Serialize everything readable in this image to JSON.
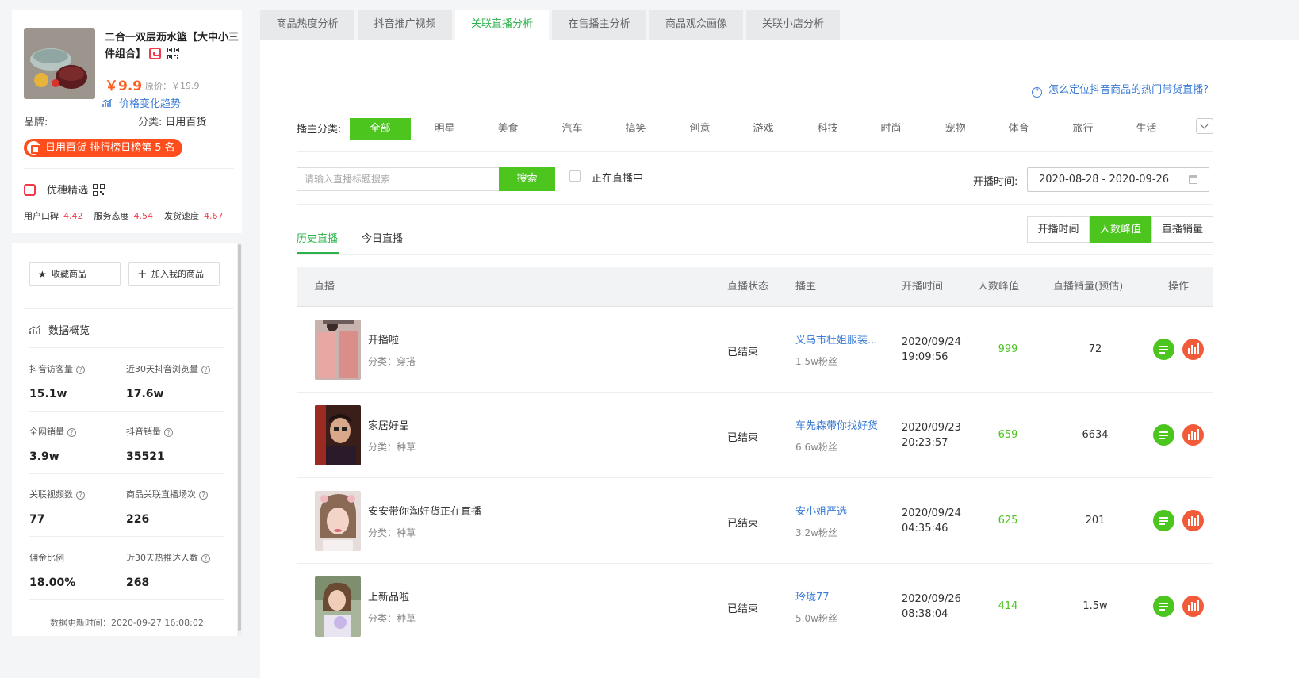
{
  "product": {
    "name": "二合一双层沥水篮【大中小三件组合】",
    "price": "￥9.9",
    "original_price": "原价：￥19.9",
    "trend_link": "价格变化趋势",
    "brand_label": "品牌:",
    "category_label": "分类:",
    "category_value": "日用百货",
    "rank_badge": "日用百货 排行榜日榜第 5 名",
    "store_name": "优穗精选",
    "scores": [
      {
        "label": "用户口碑",
        "value": "4.42"
      },
      {
        "label": "服务态度",
        "value": "4.54"
      },
      {
        "label": "发货速度",
        "value": "4.67"
      }
    ],
    "favorite_button": "收藏商品",
    "add_button": "加入我的商品"
  },
  "overview": {
    "title": "数据概览",
    "stats": [
      {
        "label": "抖音访客量",
        "value": "15.1w"
      },
      {
        "label": "近30天抖音浏览量",
        "value": "17.6w"
      },
      {
        "label": "全网销量",
        "value": "3.9w"
      },
      {
        "label": "抖音销量",
        "value": "35521"
      },
      {
        "label": "关联视频数",
        "value": "77"
      },
      {
        "label": "商品关联直播场次",
        "value": "226"
      },
      {
        "label": "佣金比例",
        "value": "18.00%"
      },
      {
        "label": "近30天热推达人数",
        "value": "268"
      }
    ],
    "updated": "数据更新时间：2020-09-27 16:08:02"
  },
  "tabs": [
    "商品热度分析",
    "抖音推广视频",
    "关联直播分析",
    "在售播主分析",
    "商品观众画像",
    "关联小店分析"
  ],
  "active_tab": "关联直播分析",
  "help_link": "怎么定位抖音商品的热门带货直播?",
  "filter": {
    "label": "播主分类:",
    "categories": [
      "全部",
      "明星",
      "美食",
      "汽车",
      "搞笑",
      "创意",
      "游戏",
      "科技",
      "时尚",
      "宠物",
      "体育",
      "旅行",
      "生活"
    ],
    "active": "全部"
  },
  "search": {
    "placeholder": "请输入直播标题搜索",
    "button": "搜索",
    "live_only_label": "正在直播中",
    "date_label": "开播时间:",
    "date_range": "2020-08-28 - 2020-09-26"
  },
  "sub_tabs": [
    "历史直播",
    "今日直播"
  ],
  "sort_buttons": [
    "开播时间",
    "人数峰值",
    "直播销量"
  ],
  "active_sort": "人数峰值",
  "table": {
    "headers": [
      "直播",
      "直播状态",
      "播主",
      "开播时间",
      "人数峰值",
      "直播销量(预估)",
      "操作"
    ],
    "rows": [
      {
        "title": "开播啦",
        "category": "分类：穿搭",
        "status": "已结束",
        "host": "义乌市杜姐服装...",
        "fans": "1.5w粉丝",
        "date": "2020/09/24",
        "time": "19:09:56",
        "peak": "999",
        "sales": "72"
      },
      {
        "title": "家居好品",
        "category": "分类：种草",
        "status": "已结束",
        "host": "车先森带你找好货",
        "fans": "6.6w粉丝",
        "date": "2020/09/23",
        "time": "20:23:57",
        "peak": "659",
        "sales": "6634"
      },
      {
        "title": "安安带你淘好货正在直播",
        "category": "分类：种草",
        "status": "已结束",
        "host": "安小姐严选",
        "fans": "3.2w粉丝",
        "date": "2020/09/24",
        "time": "04:35:46",
        "peak": "625",
        "sales": "201"
      },
      {
        "title": "上新品啦",
        "category": "分类：种草",
        "status": "已结束",
        "host": "玲珑77",
        "fans": "5.0w粉丝",
        "date": "2020/09/26",
        "time": "08:38:04",
        "peak": "414",
        "sales": "1.5w"
      }
    ]
  },
  "colors": {
    "accent_green": "#4cc51f",
    "link_blue": "#3a7bd5",
    "price_orange": "#ff5c1e",
    "score_red": "#f2394a",
    "op_orange": "#f25b3a"
  },
  "icons": [
    "shop-icon",
    "qrcode-icon",
    "trend-icon",
    "star-icon",
    "plus-icon",
    "chart-icon",
    "help-icon",
    "calendar-icon",
    "chevron-down-icon",
    "list-icon",
    "bar-chart-icon"
  ]
}
